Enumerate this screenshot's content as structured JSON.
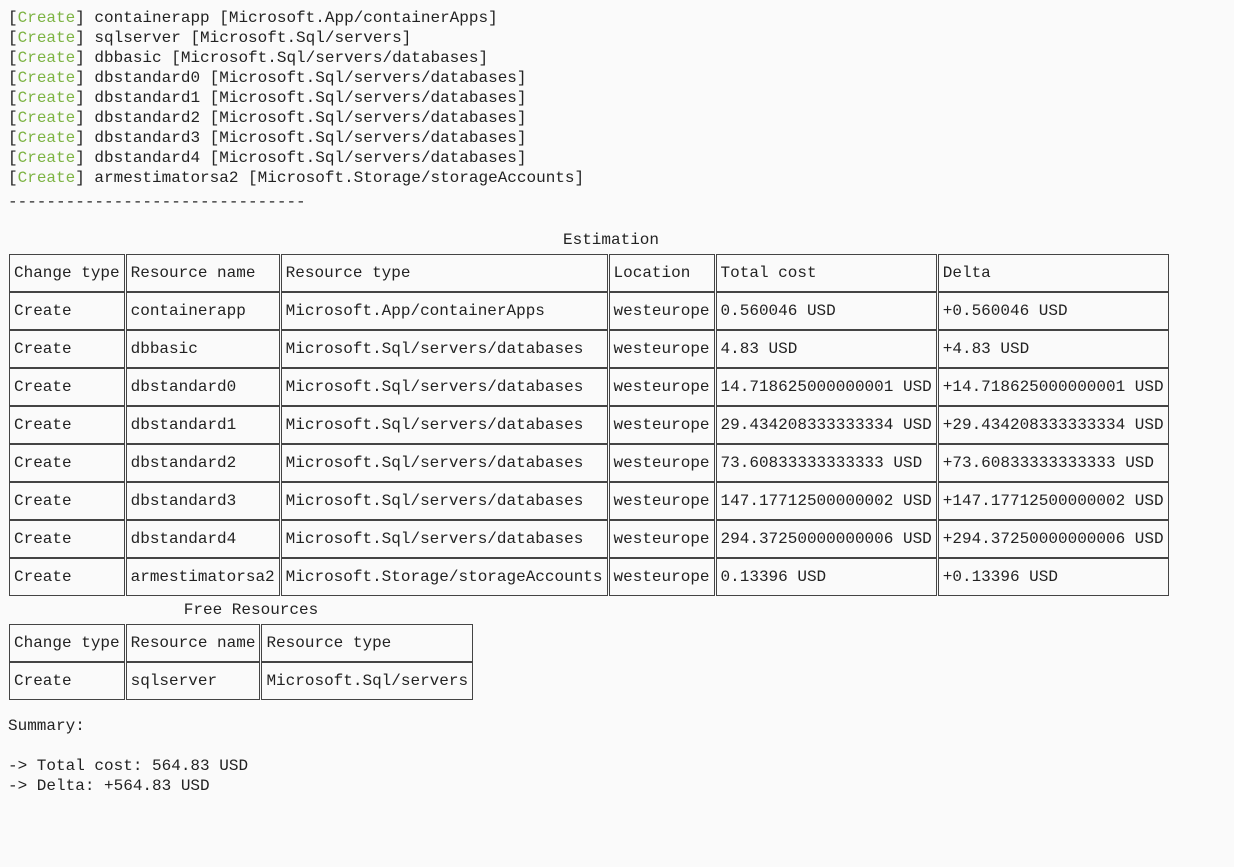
{
  "log_entries": [
    {
      "action": "Create",
      "name": "containerapp",
      "type": "Microsoft.App/containerApps"
    },
    {
      "action": "Create",
      "name": "sqlserver",
      "type": "Microsoft.Sql/servers"
    },
    {
      "action": "Create",
      "name": "dbbasic",
      "type": "Microsoft.Sql/servers/databases"
    },
    {
      "action": "Create",
      "name": "dbstandard0",
      "type": "Microsoft.Sql/servers/databases"
    },
    {
      "action": "Create",
      "name": "dbstandard1",
      "type": "Microsoft.Sql/servers/databases"
    },
    {
      "action": "Create",
      "name": "dbstandard2",
      "type": "Microsoft.Sql/servers/databases"
    },
    {
      "action": "Create",
      "name": "dbstandard3",
      "type": "Microsoft.Sql/servers/databases"
    },
    {
      "action": "Create",
      "name": "dbstandard4",
      "type": "Microsoft.Sql/servers/databases"
    },
    {
      "action": "Create",
      "name": "armestimatorsa2",
      "type": "Microsoft.Storage/storageAccounts"
    }
  ],
  "divider": "-------------------------------",
  "estimation": {
    "title": "Estimation",
    "headers": [
      "Change type",
      "Resource name",
      "Resource type",
      "Location",
      "Total cost",
      "Delta"
    ],
    "rows": [
      [
        "Create",
        "containerapp",
        "Microsoft.App/containerApps",
        "westeurope",
        "0.560046 USD",
        "+0.560046 USD"
      ],
      [
        "Create",
        "dbbasic",
        "Microsoft.Sql/servers/databases",
        "westeurope",
        "4.83 USD",
        "+4.83 USD"
      ],
      [
        "Create",
        "dbstandard0",
        "Microsoft.Sql/servers/databases",
        "westeurope",
        "14.718625000000001 USD",
        "+14.718625000000001 USD"
      ],
      [
        "Create",
        "dbstandard1",
        "Microsoft.Sql/servers/databases",
        "westeurope",
        "29.434208333333334 USD",
        "+29.434208333333334 USD"
      ],
      [
        "Create",
        "dbstandard2",
        "Microsoft.Sql/servers/databases",
        "westeurope",
        "73.60833333333333 USD",
        "+73.60833333333333 USD"
      ],
      [
        "Create",
        "dbstandard3",
        "Microsoft.Sql/servers/databases",
        "westeurope",
        "147.17712500000002 USD",
        "+147.17712500000002 USD"
      ],
      [
        "Create",
        "dbstandard4",
        "Microsoft.Sql/servers/databases",
        "westeurope",
        "294.37250000000006 USD",
        "+294.37250000000006 USD"
      ],
      [
        "Create",
        "armestimatorsa2",
        "Microsoft.Storage/storageAccounts",
        "westeurope",
        "0.13396 USD",
        "+0.13396 USD"
      ]
    ]
  },
  "free_resources": {
    "title": "Free Resources",
    "headers": [
      "Change type",
      "Resource name",
      "Resource type"
    ],
    "rows": [
      [
        "Create",
        "sqlserver",
        "Microsoft.Sql/servers"
      ]
    ]
  },
  "summary": {
    "label": "Summary:",
    "total_cost_line": "-> Total cost: 564.83 USD",
    "delta_line": "-> Delta: +564.83 USD"
  }
}
